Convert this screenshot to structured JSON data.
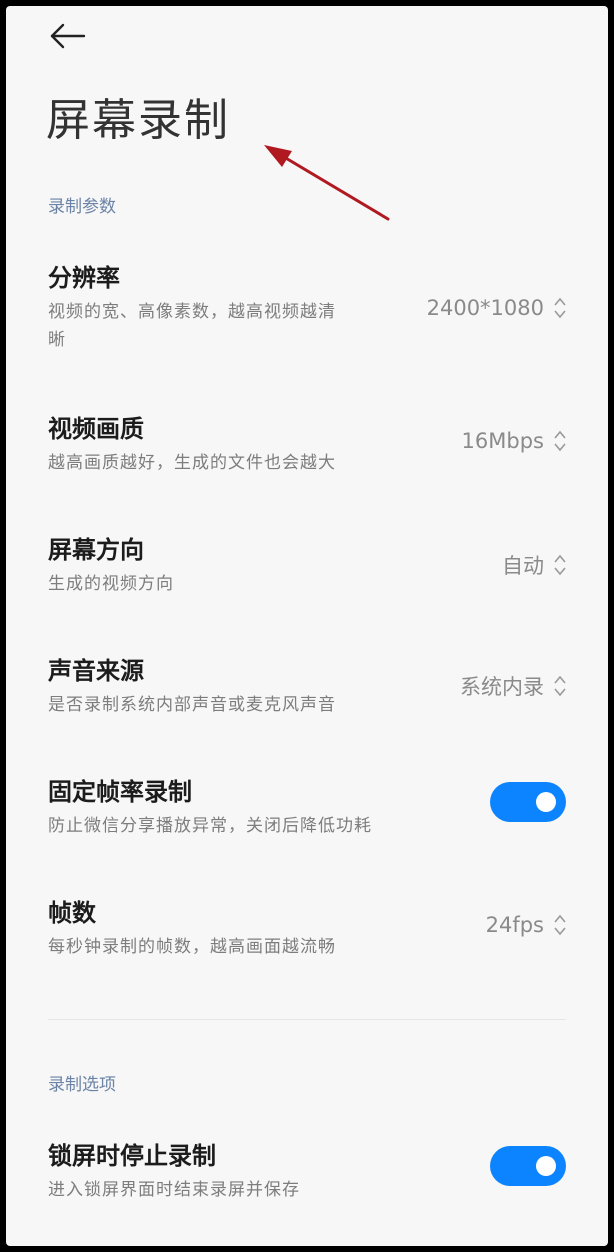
{
  "page": {
    "title": "屏幕录制",
    "back_icon": "arrow-left-icon"
  },
  "colors": {
    "accent": "#0d84ff",
    "section_label": "#6a83a6",
    "annotation_arrow": "#b0191f"
  },
  "sections": [
    {
      "label": "录制参数",
      "items": [
        {
          "label": "分辨率",
          "desc_line1": "视频的宽、高像素数，越高视频越清",
          "desc_line2": "晰",
          "value": "2400*1080"
        },
        {
          "label": "视频画质",
          "desc": "越高画质越好，生成的文件也会越大",
          "value": "16Mbps"
        },
        {
          "label": "屏幕方向",
          "desc": "生成的视频方向",
          "value": "自动"
        },
        {
          "label": "声音来源",
          "desc": "是否录制系统内部声音或麦克风声音",
          "value": "系统内录"
        },
        {
          "label": "固定帧率录制",
          "desc": "防止微信分享播放异常，关闭后降低功耗",
          "toggle": true
        },
        {
          "label": "帧数",
          "desc": "每秒钟录制的帧数，越高画面越流畅",
          "value": "24fps"
        }
      ]
    },
    {
      "label": "录制选项",
      "items": [
        {
          "label": "锁屏时停止录制",
          "desc": "进入锁屏界面时结束录屏并保存",
          "toggle": true
        }
      ]
    }
  ]
}
